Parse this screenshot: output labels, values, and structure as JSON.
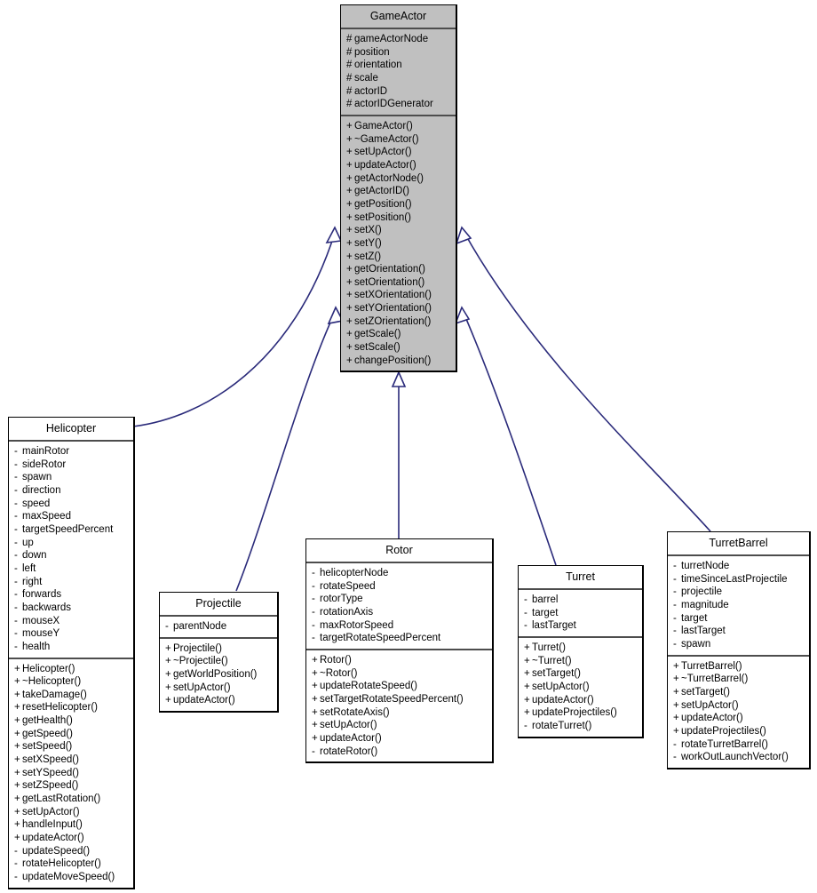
{
  "diagram": {
    "kind": "uml-class-inheritance-diagram",
    "edge_color": "#2a2a7a",
    "base_fill": "#c0c0c0",
    "derived_fill": "#ffffff"
  },
  "classes": {
    "gameactor": {
      "name": "GameActor",
      "attributes": [
        {
          "vis": "#",
          "label": "gameActorNode"
        },
        {
          "vis": "#",
          "label": "position"
        },
        {
          "vis": "#",
          "label": "orientation"
        },
        {
          "vis": "#",
          "label": "scale"
        },
        {
          "vis": "#",
          "label": "actorID"
        },
        {
          "vis": "#",
          "label": "actorIDGenerator"
        }
      ],
      "methods": [
        {
          "vis": "+",
          "label": "GameActor()"
        },
        {
          "vis": "+",
          "label": "~GameActor()"
        },
        {
          "vis": "+",
          "label": "setUpActor()"
        },
        {
          "vis": "+",
          "label": "updateActor()"
        },
        {
          "vis": "+",
          "label": "getActorNode()"
        },
        {
          "vis": "+",
          "label": "getActorID()"
        },
        {
          "vis": "+",
          "label": "getPosition()"
        },
        {
          "vis": "+",
          "label": "setPosition()"
        },
        {
          "vis": "+",
          "label": "setX()"
        },
        {
          "vis": "+",
          "label": "setY()"
        },
        {
          "vis": "+",
          "label": "setZ()"
        },
        {
          "vis": "+",
          "label": "getOrientation()"
        },
        {
          "vis": "+",
          "label": "setOrientation()"
        },
        {
          "vis": "+",
          "label": "setXOrientation()"
        },
        {
          "vis": "+",
          "label": "setYOrientation()"
        },
        {
          "vis": "+",
          "label": "setZOrientation()"
        },
        {
          "vis": "+",
          "label": "getScale()"
        },
        {
          "vis": "+",
          "label": "setScale()"
        },
        {
          "vis": "+",
          "label": "changePosition()"
        }
      ]
    },
    "helicopter": {
      "name": "Helicopter",
      "attributes": [
        {
          "vis": "-",
          "label": "mainRotor"
        },
        {
          "vis": "-",
          "label": "sideRotor"
        },
        {
          "vis": "-",
          "label": "spawn"
        },
        {
          "vis": "-",
          "label": "direction"
        },
        {
          "vis": "-",
          "label": "speed"
        },
        {
          "vis": "-",
          "label": "maxSpeed"
        },
        {
          "vis": "-",
          "label": "targetSpeedPercent"
        },
        {
          "vis": "-",
          "label": "up"
        },
        {
          "vis": "-",
          "label": "down"
        },
        {
          "vis": "-",
          "label": "left"
        },
        {
          "vis": "-",
          "label": "right"
        },
        {
          "vis": "-",
          "label": "forwards"
        },
        {
          "vis": "-",
          "label": "backwards"
        },
        {
          "vis": "-",
          "label": "mouseX"
        },
        {
          "vis": "-",
          "label": "mouseY"
        },
        {
          "vis": "-",
          "label": "health"
        }
      ],
      "methods": [
        {
          "vis": "+",
          "label": "Helicopter()"
        },
        {
          "vis": "+",
          "label": "~Helicopter()"
        },
        {
          "vis": "+",
          "label": "takeDamage()"
        },
        {
          "vis": "+",
          "label": "resetHelicopter()"
        },
        {
          "vis": "+",
          "label": "getHealth()"
        },
        {
          "vis": "+",
          "label": "getSpeed()"
        },
        {
          "vis": "+",
          "label": "setSpeed()"
        },
        {
          "vis": "+",
          "label": "setXSpeed()"
        },
        {
          "vis": "+",
          "label": "setYSpeed()"
        },
        {
          "vis": "+",
          "label": "setZSpeed()"
        },
        {
          "vis": "+",
          "label": "getLastRotation()"
        },
        {
          "vis": "+",
          "label": "setUpActor()"
        },
        {
          "vis": "+",
          "label": "handleInput()"
        },
        {
          "vis": "+",
          "label": "updateActor()"
        },
        {
          "vis": "-",
          "label": "updateSpeed()"
        },
        {
          "vis": "-",
          "label": "rotateHelicopter()"
        },
        {
          "vis": "-",
          "label": "updateMoveSpeed()"
        }
      ]
    },
    "projectile": {
      "name": "Projectile",
      "attributes": [
        {
          "vis": "-",
          "label": "parentNode"
        }
      ],
      "methods": [
        {
          "vis": "+",
          "label": "Projectile()"
        },
        {
          "vis": "+",
          "label": "~Projectile()"
        },
        {
          "vis": "+",
          "label": "getWorldPosition()"
        },
        {
          "vis": "+",
          "label": "setUpActor()"
        },
        {
          "vis": "+",
          "label": "updateActor()"
        }
      ]
    },
    "rotor": {
      "name": "Rotor",
      "attributes": [
        {
          "vis": "-",
          "label": "helicopterNode"
        },
        {
          "vis": "-",
          "label": "rotateSpeed"
        },
        {
          "vis": "-",
          "label": "rotorType"
        },
        {
          "vis": "-",
          "label": "rotationAxis"
        },
        {
          "vis": "-",
          "label": "maxRotorSpeed"
        },
        {
          "vis": "-",
          "label": "targetRotateSpeedPercent"
        }
      ],
      "methods": [
        {
          "vis": "+",
          "label": "Rotor()"
        },
        {
          "vis": "+",
          "label": "~Rotor()"
        },
        {
          "vis": "+",
          "label": "updateRotateSpeed()"
        },
        {
          "vis": "+",
          "label": "setTargetRotateSpeedPercent()"
        },
        {
          "vis": "+",
          "label": "setRotateAxis()"
        },
        {
          "vis": "+",
          "label": "setUpActor()"
        },
        {
          "vis": "+",
          "label": "updateActor()"
        },
        {
          "vis": "-",
          "label": "rotateRotor()"
        }
      ]
    },
    "turret": {
      "name": "Turret",
      "attributes": [
        {
          "vis": "-",
          "label": "barrel"
        },
        {
          "vis": "-",
          "label": "target"
        },
        {
          "vis": "-",
          "label": "lastTarget"
        }
      ],
      "methods": [
        {
          "vis": "+",
          "label": "Turret()"
        },
        {
          "vis": "+",
          "label": "~Turret()"
        },
        {
          "vis": "+",
          "label": "setTarget()"
        },
        {
          "vis": "+",
          "label": "setUpActor()"
        },
        {
          "vis": "+",
          "label": "updateActor()"
        },
        {
          "vis": "+",
          "label": "updateProjectiles()"
        },
        {
          "vis": "-",
          "label": "rotateTurret()"
        }
      ]
    },
    "turretbarrel": {
      "name": "TurretBarrel",
      "attributes": [
        {
          "vis": "-",
          "label": "turretNode"
        },
        {
          "vis": "-",
          "label": "timeSinceLastProjectile"
        },
        {
          "vis": "-",
          "label": "projectile"
        },
        {
          "vis": "-",
          "label": "magnitude"
        },
        {
          "vis": "-",
          "label": "target"
        },
        {
          "vis": "-",
          "label": "lastTarget"
        },
        {
          "vis": "-",
          "label": "spawn"
        }
      ],
      "methods": [
        {
          "vis": "+",
          "label": "TurretBarrel()"
        },
        {
          "vis": "+",
          "label": "~TurretBarrel()"
        },
        {
          "vis": "+",
          "label": "setTarget()"
        },
        {
          "vis": "+",
          "label": "setUpActor()"
        },
        {
          "vis": "+",
          "label": "updateActor()"
        },
        {
          "vis": "+",
          "label": "updateProjectiles()"
        },
        {
          "vis": "-",
          "label": "rotateTurretBarrel()"
        },
        {
          "vis": "-",
          "label": "workOutLaunchVector()"
        }
      ]
    }
  },
  "edges": [
    {
      "from": "helicopter",
      "to": "gameActor",
      "relation": "inheritance"
    },
    {
      "from": "projectile",
      "to": "gameActor",
      "relation": "inheritance"
    },
    {
      "from": "rotor",
      "to": "gameActor",
      "relation": "inheritance"
    },
    {
      "from": "turret",
      "to": "gameActor",
      "relation": "inheritance"
    },
    {
      "from": "turretBarrel",
      "to": "gameActor",
      "relation": "inheritance"
    }
  ]
}
